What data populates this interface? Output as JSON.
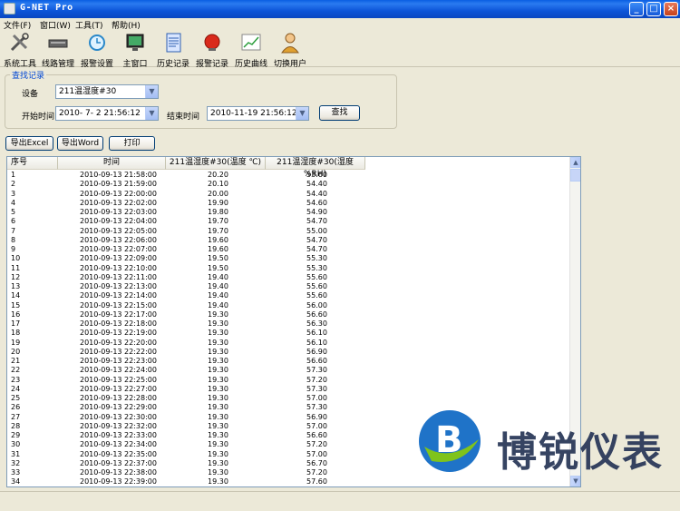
{
  "window": {
    "title": "G-NET Pro",
    "min": "_",
    "max": "□",
    "close": "×"
  },
  "menu": [
    {
      "label": "文件(F)"
    },
    {
      "label": "窗口(W)"
    },
    {
      "label": "工具(T)"
    },
    {
      "label": "帮助(H)"
    }
  ],
  "toolbar": [
    {
      "label": "系统工具",
      "icon": "tools-icon"
    },
    {
      "label": "线路管理",
      "icon": "device-icon"
    },
    {
      "label": "报警设置",
      "icon": "alarm-clock-icon"
    },
    {
      "label": "主窗口",
      "icon": "monitor-icon"
    },
    {
      "label": "历史记录",
      "icon": "document-icon"
    },
    {
      "label": "报警记录",
      "icon": "alarm-bell-icon"
    },
    {
      "label": "历史曲线",
      "icon": "chart-icon"
    },
    {
      "label": "切换用户",
      "icon": "user-icon"
    }
  ],
  "search": {
    "legend": "查找记录",
    "device_label": "设备",
    "device_value": "211温湿度#30",
    "start_label": "开始时间",
    "start_value": "2010- 7- 2 21:56:12",
    "end_label": "结束时间",
    "end_value": "2010-11-19 21:56:12",
    "find_button": "查找"
  },
  "actions": {
    "export_excel": "导出Excel",
    "export_word": "导出Word",
    "print": "打印"
  },
  "table": {
    "columns": [
      "序号",
      "时间",
      "211温湿度#30(温度 ℃)",
      "211温湿度#30(湿度 %RH)"
    ],
    "rows": [
      [
        "1",
        "2010-09-13 21:58:00",
        "20.20",
        "53.60"
      ],
      [
        "2",
        "2010-09-13 21:59:00",
        "20.10",
        "54.40"
      ],
      [
        "3",
        "2010-09-13 22:00:00",
        "20.00",
        "54.40"
      ],
      [
        "4",
        "2010-09-13 22:02:00",
        "19.90",
        "54.60"
      ],
      [
        "5",
        "2010-09-13 22:03:00",
        "19.80",
        "54.90"
      ],
      [
        "6",
        "2010-09-13 22:04:00",
        "19.70",
        "54.70"
      ],
      [
        "7",
        "2010-09-13 22:05:00",
        "19.70",
        "55.00"
      ],
      [
        "8",
        "2010-09-13 22:06:00",
        "19.60",
        "54.70"
      ],
      [
        "9",
        "2010-09-13 22:07:00",
        "19.60",
        "54.70"
      ],
      [
        "10",
        "2010-09-13 22:09:00",
        "19.50",
        "55.30"
      ],
      [
        "11",
        "2010-09-13 22:10:00",
        "19.50",
        "55.30"
      ],
      [
        "12",
        "2010-09-13 22:11:00",
        "19.40",
        "55.60"
      ],
      [
        "13",
        "2010-09-13 22:13:00",
        "19.40",
        "55.60"
      ],
      [
        "14",
        "2010-09-13 22:14:00",
        "19.40",
        "55.60"
      ],
      [
        "15",
        "2010-09-13 22:15:00",
        "19.40",
        "56.00"
      ],
      [
        "16",
        "2010-09-13 22:17:00",
        "19.30",
        "56.60"
      ],
      [
        "17",
        "2010-09-13 22:18:00",
        "19.30",
        "56.30"
      ],
      [
        "18",
        "2010-09-13 22:19:00",
        "19.30",
        "56.10"
      ],
      [
        "19",
        "2010-09-13 22:20:00",
        "19.30",
        "56.10"
      ],
      [
        "20",
        "2010-09-13 22:22:00",
        "19.30",
        "56.90"
      ],
      [
        "21",
        "2010-09-13 22:23:00",
        "19.30",
        "56.60"
      ],
      [
        "22",
        "2010-09-13 22:24:00",
        "19.30",
        "57.30"
      ],
      [
        "23",
        "2010-09-13 22:25:00",
        "19.30",
        "57.20"
      ],
      [
        "24",
        "2010-09-13 22:27:00",
        "19.30",
        "57.30"
      ],
      [
        "25",
        "2010-09-13 22:28:00",
        "19.30",
        "57.00"
      ],
      [
        "26",
        "2010-09-13 22:29:00",
        "19.30",
        "57.30"
      ],
      [
        "27",
        "2010-09-13 22:30:00",
        "19.30",
        "56.90"
      ],
      [
        "28",
        "2010-09-13 22:32:00",
        "19.30",
        "57.00"
      ],
      [
        "29",
        "2010-09-13 22:33:00",
        "19.30",
        "56.60"
      ],
      [
        "30",
        "2010-09-13 22:34:00",
        "19.30",
        "57.20"
      ],
      [
        "31",
        "2010-09-13 22:35:00",
        "19.30",
        "57.00"
      ],
      [
        "32",
        "2010-09-13 22:37:00",
        "19.30",
        "56.70"
      ],
      [
        "33",
        "2010-09-13 22:38:00",
        "19.30",
        "57.20"
      ],
      [
        "34",
        "2010-09-13 22:39:00",
        "19.30",
        "57.60"
      ]
    ]
  },
  "watermark": {
    "text": "博锐仪表",
    "brand_color": "#1f73c8",
    "accent_color": "#7fc31c"
  }
}
